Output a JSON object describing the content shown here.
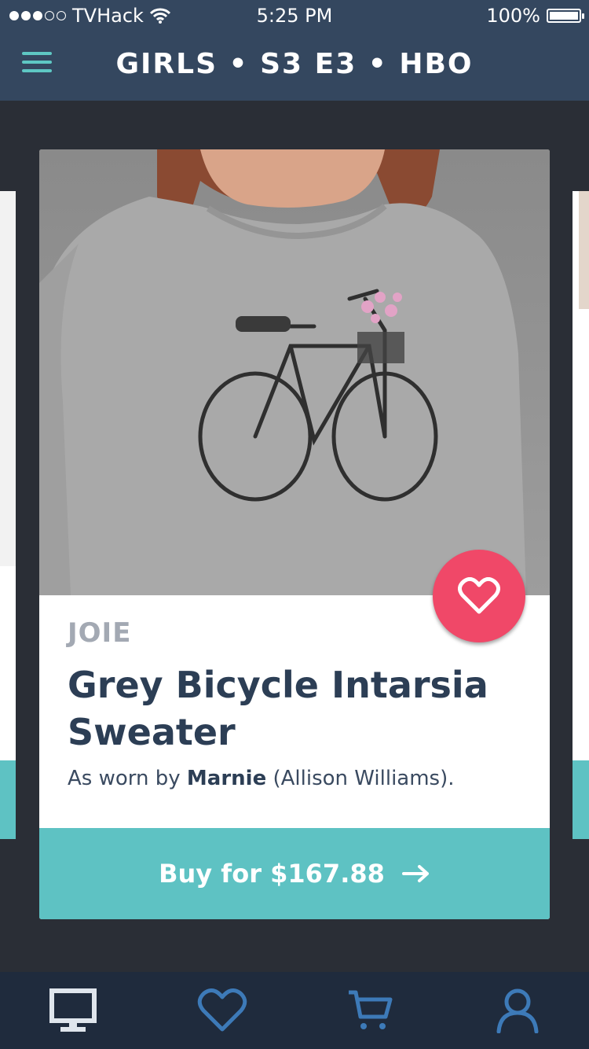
{
  "status_bar": {
    "carrier": "TVHack",
    "time": "5:25 PM",
    "battery": "100%"
  },
  "nav": {
    "title": "GIRLS • S3 E3 • HBO",
    "menu_icon": "hamburger-menu-icon"
  },
  "product": {
    "brand": "JOIE",
    "name": "Grey Bicycle Intarsia Sweater",
    "worn_prefix": "As worn by",
    "character": "Marnie",
    "actor": "(Allison Williams).",
    "buy_label": "Buy for $167.88",
    "buy_icon": "arrow-right-icon",
    "favorite_icon": "heart-icon"
  },
  "colors": {
    "nav_bg": "#34475f",
    "accent_teal": "#5ec2c3",
    "favorite_red": "#f04868",
    "page_bg": "#2a2e36",
    "tabbar_bg": "#1f2b3d",
    "tab_icon": "#3d7ab8"
  },
  "tabbar": {
    "tabs": [
      {
        "name": "watch",
        "icon": "tv-monitor-icon",
        "active": true
      },
      {
        "name": "favorites",
        "icon": "heart-icon",
        "active": false
      },
      {
        "name": "cart",
        "icon": "cart-icon",
        "active": false
      },
      {
        "name": "profile",
        "icon": "user-icon",
        "active": false
      }
    ]
  }
}
